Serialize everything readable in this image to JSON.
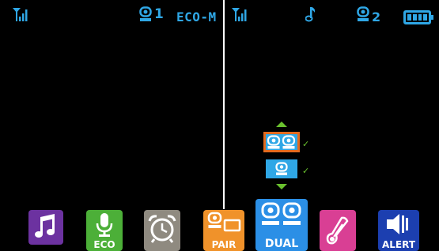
{
  "left_panel": {
    "camera_label": "1",
    "mode_label": "ECO-M"
  },
  "right_panel": {
    "camera_label": "2"
  },
  "picker": {
    "options": [
      "dual-camera",
      "single-camera"
    ],
    "selected_index": 0
  },
  "toolbar": {
    "music_label": "",
    "eco_label": "ECO",
    "alarm_label": "",
    "pair_label": "PAIR",
    "dual_label": "DUAL",
    "temp_label": "",
    "alert_label": "ALERT"
  },
  "colors": {
    "accent": "#2fa7e6",
    "music": "#6c32a0",
    "eco": "#4caf38",
    "alarm": "#8f8a80",
    "pair": "#f0922a",
    "dual": "#2b8fe6",
    "temp": "#d93f94",
    "alert": "#1c3fb0",
    "check": "#6ac12e",
    "selection": "#e26a1f"
  },
  "icons": [
    "signal-icon",
    "camera-icon",
    "music-note-icon",
    "battery-icon",
    "microphone-icon",
    "alarm-clock-icon",
    "thermometer-icon",
    "speaker-icon"
  ],
  "battery_level": 1.0
}
